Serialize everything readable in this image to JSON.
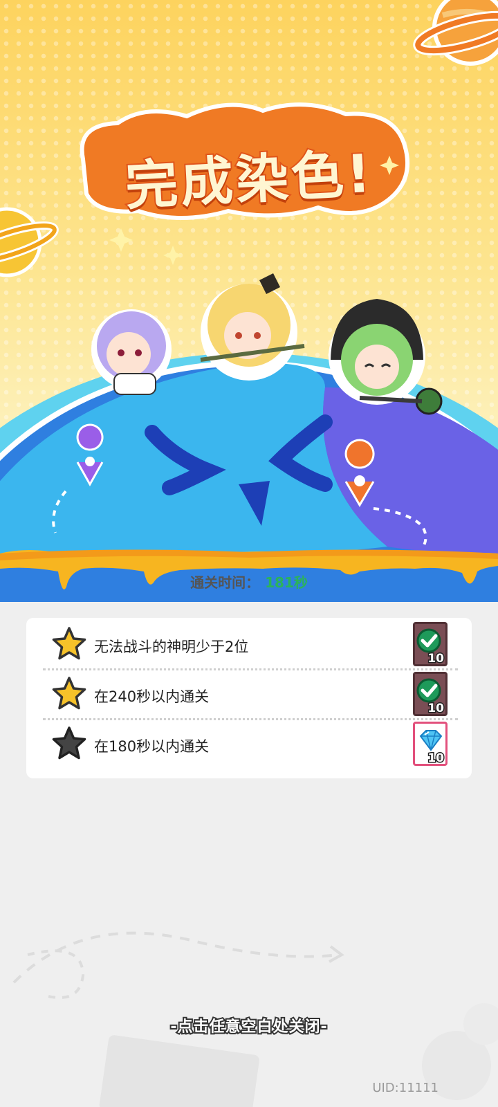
{
  "header": {
    "title": "完成染色!"
  },
  "result": {
    "time_label": "通关时间：",
    "time_value": "181秒"
  },
  "conditions": [
    {
      "label": "无法战斗的神明少于2位",
      "achieved": true,
      "reward_icon": "check-badge-icon",
      "reward_count": "10"
    },
    {
      "label": "在240秒以内通关",
      "achieved": true,
      "reward_icon": "check-badge-icon",
      "reward_count": "10"
    },
    {
      "label": "在180秒以内通关",
      "achieved": false,
      "reward_icon": "diamond-icon",
      "reward_count": "10"
    }
  ],
  "footer": {
    "close_hint": "-点击任意空白处关闭-",
    "uid": "UID:11111"
  },
  "colors": {
    "star_achieved": "#f6c22a",
    "star_unachieved": "#444444",
    "time_value": "#2bb35a",
    "planet_blue": "#3bb6ee",
    "title_orange": "#f07a24"
  }
}
